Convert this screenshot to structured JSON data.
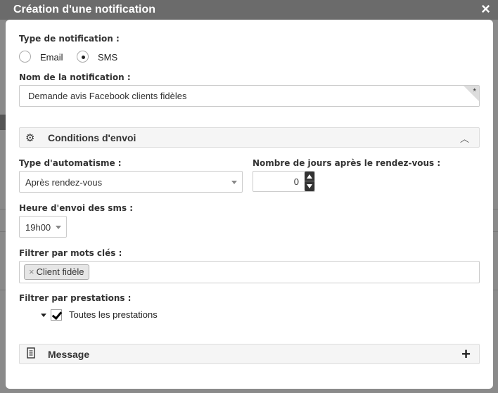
{
  "modal": {
    "title": "Création d'une notification",
    "close_icon": "×"
  },
  "type_notification": {
    "label": "Type de notification :",
    "options": [
      {
        "label": "Email",
        "selected": false
      },
      {
        "label": "SMS",
        "selected": true
      }
    ]
  },
  "nom_notification": {
    "label": "Nom de la notification :",
    "value": "Demande avis Facebook clients fidèles",
    "required_marker": "*"
  },
  "conditions": {
    "title": "Conditions d'envoi",
    "icon": "gear-icon",
    "expanded": true,
    "type_automatisme": {
      "label": "Type d'automatisme :",
      "value": "Après rendez-vous"
    },
    "nombre_jours": {
      "label": "Nombre de jours après le rendez-vous :",
      "value": "0"
    },
    "heure_envoi": {
      "label": "Heure d'envoi des sms :",
      "value": "19h00"
    },
    "mots_cles": {
      "label": "Filtrer par mots clés :",
      "tags": [
        "Client fidèle"
      ]
    },
    "prestations": {
      "label": "Filtrer par prestations :",
      "item_label": "Toutes les prestations",
      "checked": true
    }
  },
  "message_section": {
    "title": "Message",
    "icon": "document-icon",
    "expand_symbol": "+"
  },
  "colors": {
    "titlebar": "#6b6b6b",
    "section_bg": "#f5f5f5"
  }
}
